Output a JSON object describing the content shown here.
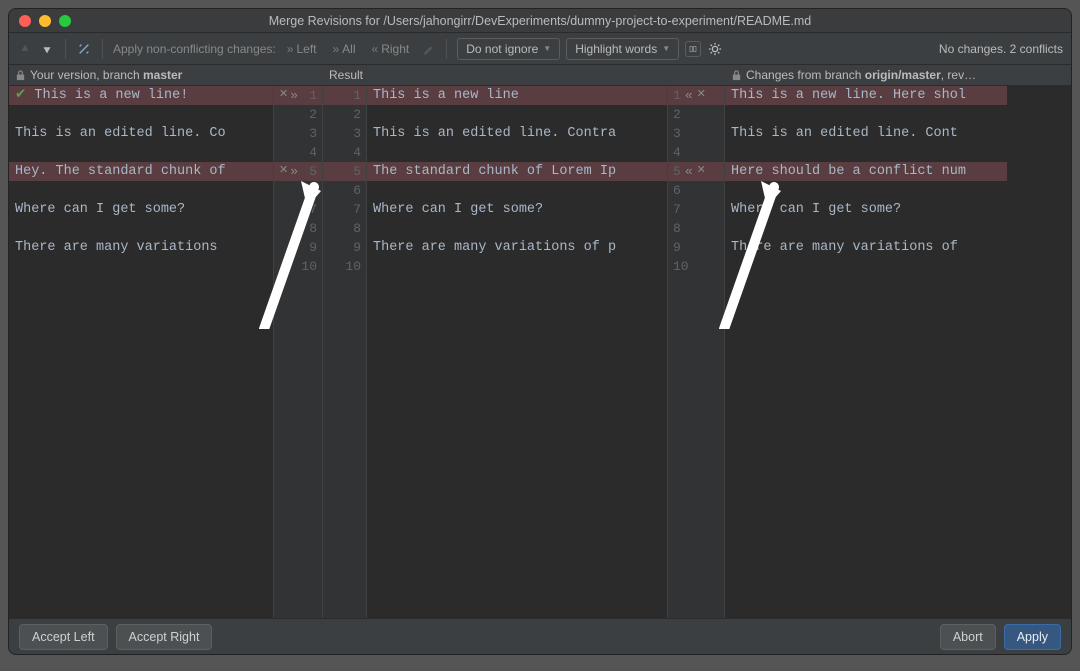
{
  "window": {
    "title": "Merge Revisions for /Users/jahongirr/DevExperiments/dummy-project-to-experiment/README.md"
  },
  "toolbar": {
    "apply_label": "Apply non-conflicting changes:",
    "left_btn": "Left",
    "all_btn": "All",
    "right_btn": "Right",
    "ignore_dd": "Do not ignore",
    "highlight_dd": "Highlight words",
    "status": "No changes. 2 conflicts"
  },
  "headers": {
    "left_pre": "Your version, branch ",
    "left_branch": "master",
    "center": "Result",
    "right_pre": "Changes from branch ",
    "right_branch": "origin/master",
    "right_post": ", rev…"
  },
  "left_lines": [
    "This is a new line!",
    "",
    "This is an edited line. Co",
    "",
    "Hey. The standard chunk of",
    "",
    "Where can I get some?",
    "",
    "There are many variations",
    ""
  ],
  "center_lines": [
    "This is a new line",
    "",
    "This is an edited line. Contra",
    "",
    "The standard chunk of Lorem Ip",
    "",
    "Where can I get some?",
    "",
    "There are many variations of p",
    ""
  ],
  "right_lines": [
    "This is a new line. Here shol",
    "",
    "This is an edited line. Cont",
    "",
    "Here should be a conflict num",
    "",
    "Where can I get some?",
    "",
    "There are many variations of",
    ""
  ],
  "linenums": [
    "1",
    "2",
    "3",
    "4",
    "5",
    "6",
    "7",
    "8",
    "9",
    "10"
  ],
  "conflict_rows": [
    0,
    4
  ],
  "footer": {
    "accept_left": "Accept Left",
    "accept_right": "Accept Right",
    "abort": "Abort",
    "apply": "Apply"
  }
}
